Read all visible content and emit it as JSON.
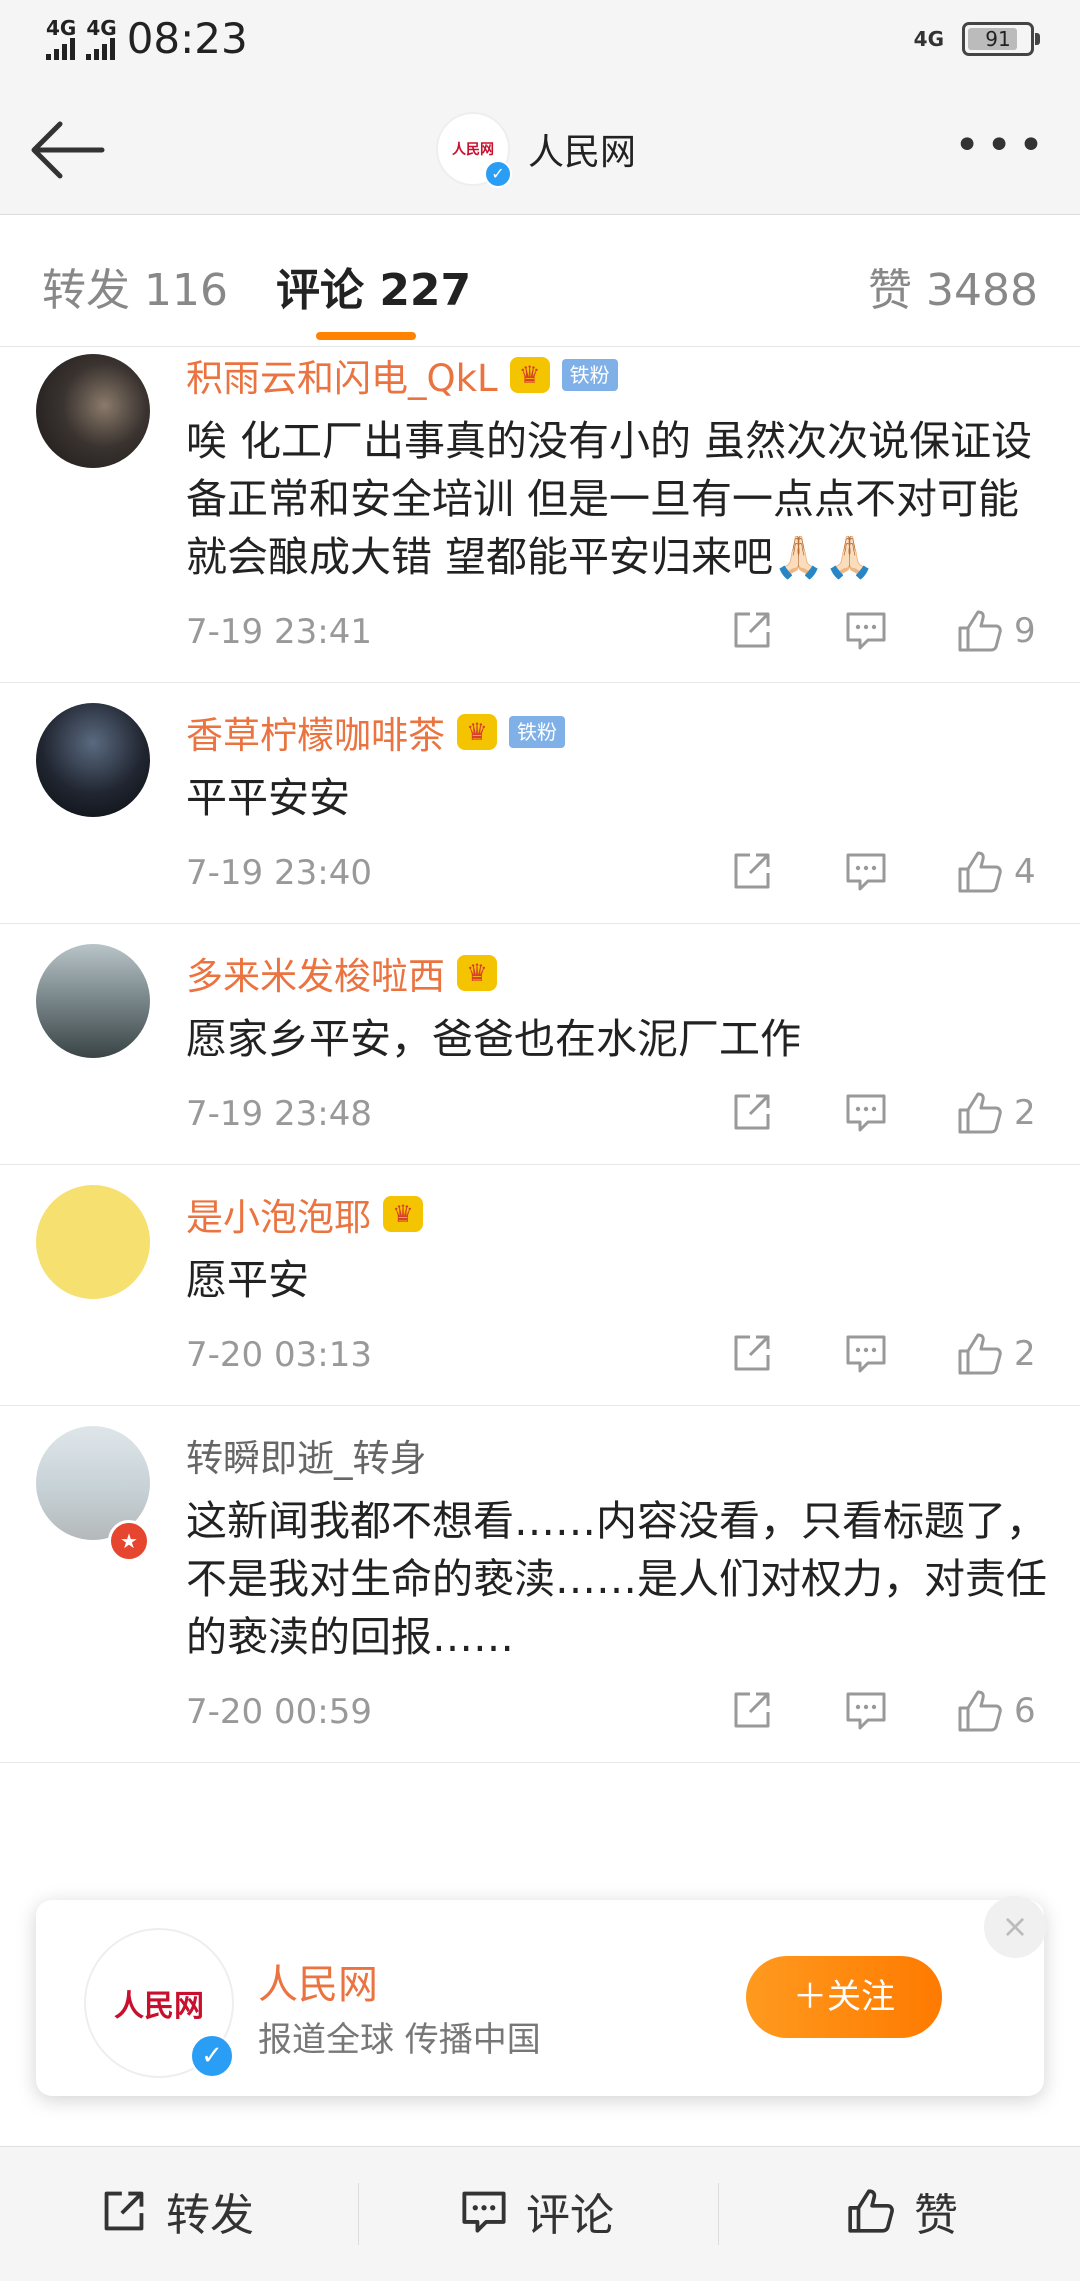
{
  "status": {
    "time": "08:23",
    "net1": "4G",
    "net2": "4G",
    "net_right": "4G",
    "battery": 91
  },
  "nav": {
    "title": "人民网",
    "logo_text": "人民网"
  },
  "tabs": {
    "repost": "转发 116",
    "comment": "评论 227",
    "like": "赞 3488"
  },
  "comments": [
    {
      "user": "积雨云和闪电_QkL",
      "crown": true,
      "fan": "铁粉",
      "text": "唉 化工厂出事真的没有小的 虽然次次说保证设备正常和安全培训 但是一旦有一点点不对可能就会酿成大错 望都能平安归来吧🙏🏻🙏🏻",
      "time": "7-19 23:41",
      "likes": "9"
    },
    {
      "user": "香草柠檬咖啡茶",
      "crown": true,
      "fan": "铁粉",
      "text": "平平安安",
      "time": "7-19 23:40",
      "likes": "4"
    },
    {
      "user": "多来米发梭啦西",
      "crown": true,
      "fan": "",
      "text": "愿家乡平安，爸爸也在水泥厂工作",
      "time": "7-19 23:48",
      "likes": "2"
    },
    {
      "user": "是小泡泡耶",
      "crown": true,
      "fan": "",
      "text": "愿平安",
      "time": "7-20 03:13",
      "likes": "2"
    },
    {
      "user": "转瞬即逝_转身",
      "crown": false,
      "fan": "",
      "text": "这新闻我都不想看……内容没看，只看标题了，不是我对生命的亵渎……是人们对权力，对责任的亵渎的回报……",
      "time": "7-20 00:59",
      "likes": "6"
    }
  ],
  "popup": {
    "name": "人民网",
    "slogan": "报道全球 传播中国",
    "follow": "＋关注",
    "close": "×",
    "logo_text": "人民网"
  },
  "bottom": {
    "repost": "转发",
    "comment": "评论",
    "like": "赞"
  },
  "icons": {
    "crown": "crown-icon",
    "verified": "verified-icon",
    "share": "share-icon",
    "comment": "comment-icon",
    "like": "thumb-up-icon"
  },
  "colors": {
    "accent": "#ff8200",
    "username": "#eb7340",
    "fan_badge": "#7fb0e8"
  }
}
